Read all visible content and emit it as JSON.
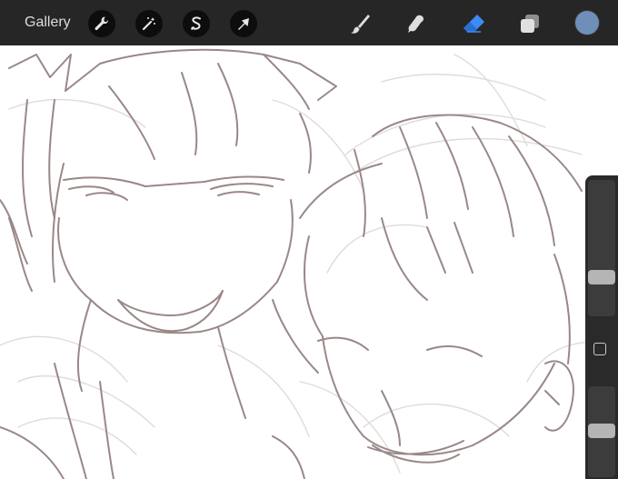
{
  "topbar": {
    "gallery_label": "Gallery",
    "actions": [
      {
        "name": "wrench-icon"
      },
      {
        "name": "magic-wand-icon"
      },
      {
        "name": "selection-s-icon"
      },
      {
        "name": "transform-arrow-icon"
      }
    ],
    "tools": [
      {
        "name": "brush-icon"
      },
      {
        "name": "smudge-icon"
      },
      {
        "name": "eraser-icon",
        "active": true
      },
      {
        "name": "layers-icon"
      }
    ],
    "active_color": "#6f8fb8",
    "accent_color": "#3d8bf5"
  },
  "sidebar": {
    "brush_size_level": 0.34,
    "opacity_level": 0.55
  }
}
